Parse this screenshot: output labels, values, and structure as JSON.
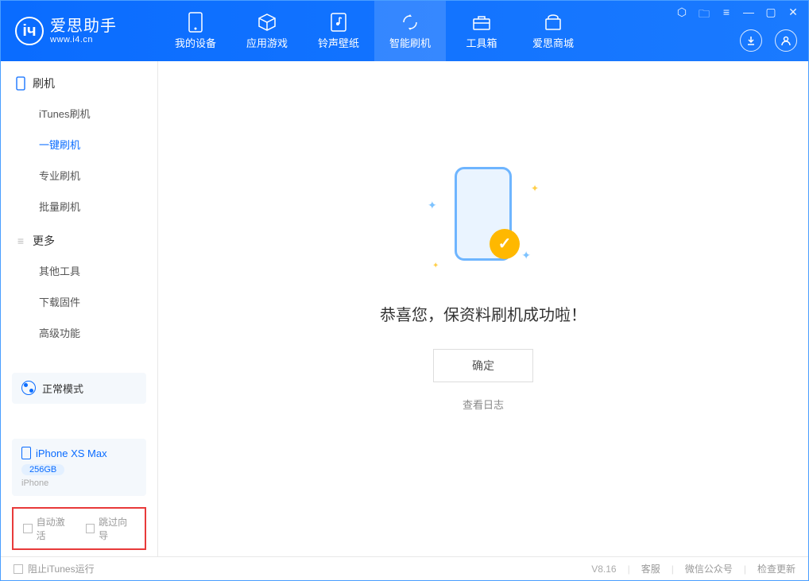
{
  "header": {
    "logo_title": "爱思助手",
    "logo_sub": "www.i4.cn",
    "tabs": [
      {
        "label": "我的设备",
        "icon": "device-icon"
      },
      {
        "label": "应用游戏",
        "icon": "cube-icon"
      },
      {
        "label": "铃声壁纸",
        "icon": "music-icon"
      },
      {
        "label": "智能刷机",
        "icon": "refresh-icon"
      },
      {
        "label": "工具箱",
        "icon": "toolbox-icon"
      },
      {
        "label": "爱思商城",
        "icon": "store-icon"
      }
    ]
  },
  "sidebar": {
    "section1_title": "刷机",
    "section1_items": [
      "iTunes刷机",
      "一键刷机",
      "专业刷机",
      "批量刷机"
    ],
    "section2_title": "更多",
    "section2_items": [
      "其他工具",
      "下载固件",
      "高级功能"
    ],
    "mode_label": "正常模式",
    "device_name": "iPhone XS Max",
    "device_storage": "256GB",
    "device_type": "iPhone",
    "checkbox1": "自动激活",
    "checkbox2": "跳过向导"
  },
  "main": {
    "success_message": "恭喜您，保资料刷机成功啦！",
    "confirm_button": "确定",
    "view_log": "查看日志"
  },
  "footer": {
    "block_itunes": "阻止iTunes运行",
    "version": "V8.16",
    "link1": "客服",
    "link2": "微信公众号",
    "link3": "检查更新"
  }
}
